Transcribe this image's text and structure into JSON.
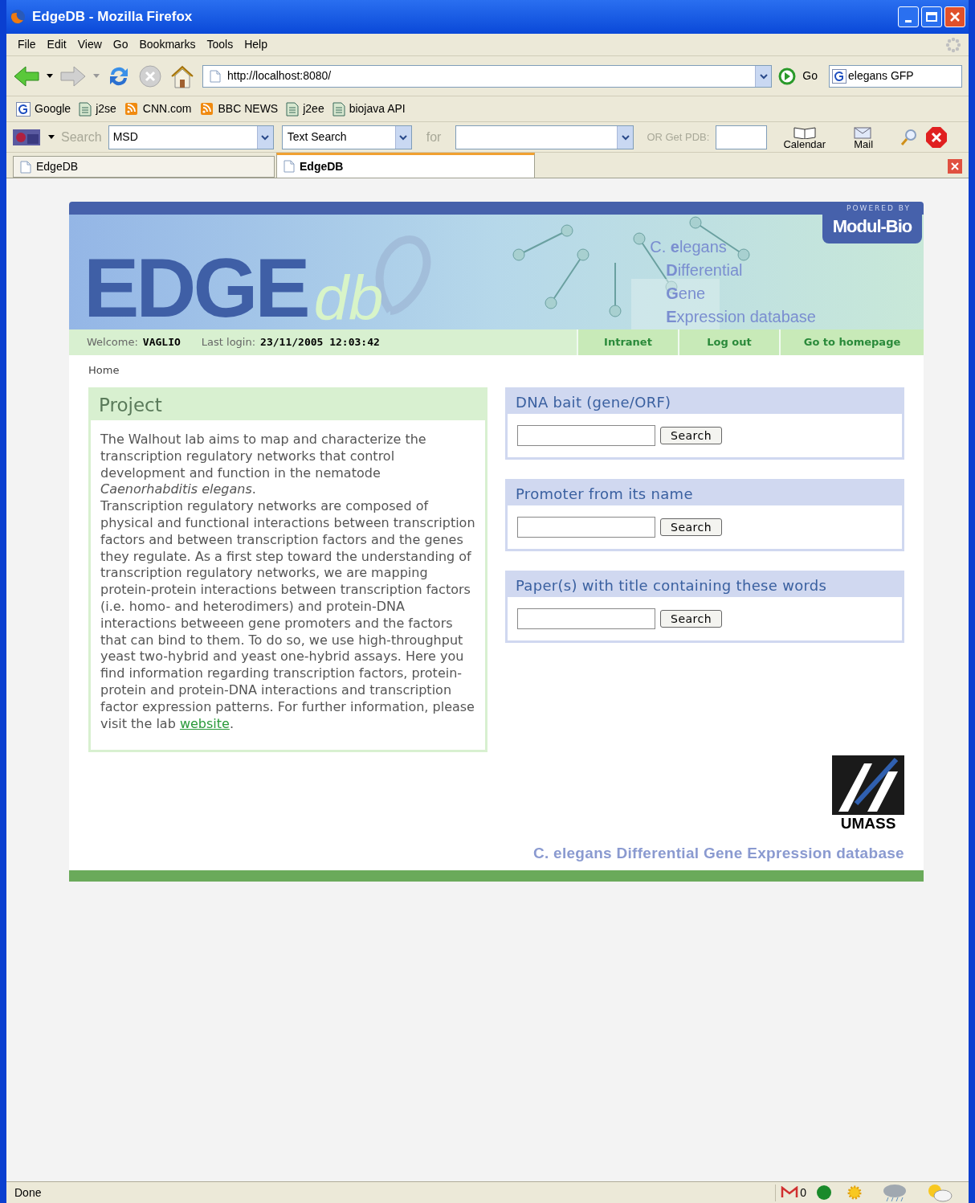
{
  "window": {
    "title": "EdgeDB - Mozilla Firefox"
  },
  "menu": [
    "File",
    "Edit",
    "View",
    "Go",
    "Bookmarks",
    "Tools",
    "Help"
  ],
  "nav": {
    "url": "http://localhost:8080/",
    "go": "Go",
    "search_value": "elegans GFP"
  },
  "bookmarks": [
    {
      "label": "Google",
      "kind": "google"
    },
    {
      "label": "j2se",
      "kind": "page"
    },
    {
      "label": "CNN.com",
      "kind": "feed"
    },
    {
      "label": "BBC NEWS",
      "kind": "feed"
    },
    {
      "label": "j2ee",
      "kind": "page"
    },
    {
      "label": "biojava API",
      "kind": "page"
    }
  ],
  "ebi_toolbar": {
    "search_label": "Search",
    "database": "MSD",
    "search_type": "Text Search",
    "for_label": "for",
    "pdb_label": "OR Get PDB:",
    "calendar": "Calendar",
    "mail": "Mail"
  },
  "tabs": [
    {
      "label": "EdgeDB",
      "selected": false
    },
    {
      "label": "EdgeDB",
      "selected": true
    }
  ],
  "header": {
    "logo_main": "EDGE",
    "logo_sub": "db",
    "powered_by": "POWERED BY",
    "brand": "Modul-Bio",
    "tagline": [
      "C. **e**legans",
      "**D**ifferential",
      "**G**ene",
      "**E**xpression database"
    ]
  },
  "welcome_bar": {
    "welcome_label": "Welcome:",
    "user": "VAGLIO",
    "last_login_label": "Last login:",
    "last_login": "23/11/2005 12:03:42",
    "links": [
      "Intranet",
      "Log out",
      "Go to homepage"
    ]
  },
  "breadcrumb": "Home",
  "project": {
    "title": "Project",
    "paragraphs": [
      "The Walhout lab aims to map and characterize the transcription regulatory networks that control development and function in the nematode *Caenorhabditis elegans*."
    ],
    "last_paragraph": "Transcription regulatory networks are composed of physical and functional interactions between transcription factors and between transcription factors and the genes they regulate. As a first step toward the understanding of transcription regulatory networks, we are mapping protein-protein interactions between transcription factors (i.e. homo- and heterodimers) and protein-DNA interactions betweeen gene promoters and the factors that can bind to them. To do so, we use high-throughput yeast two-hybrid and yeast one-hybrid assays. Here you find information regarding transcription factors, protein-protein and protein-DNA interactions and transcription factor expression patterns. For further information, please visit the lab ",
    "link": "website",
    "after_link": "."
  },
  "search_panels": [
    {
      "title": "DNA bait (gene/ORF)",
      "button": "Search"
    },
    {
      "title": "Promoter from its name",
      "button": "Search"
    },
    {
      "title": "Paper(s) with title containing these words",
      "button": "Search"
    }
  ],
  "footer": {
    "logo": "UMASS",
    "tagline": "C. elegans Differential Gene Expression database"
  },
  "status_bar": {
    "text": "Done",
    "mail_count": "0"
  }
}
